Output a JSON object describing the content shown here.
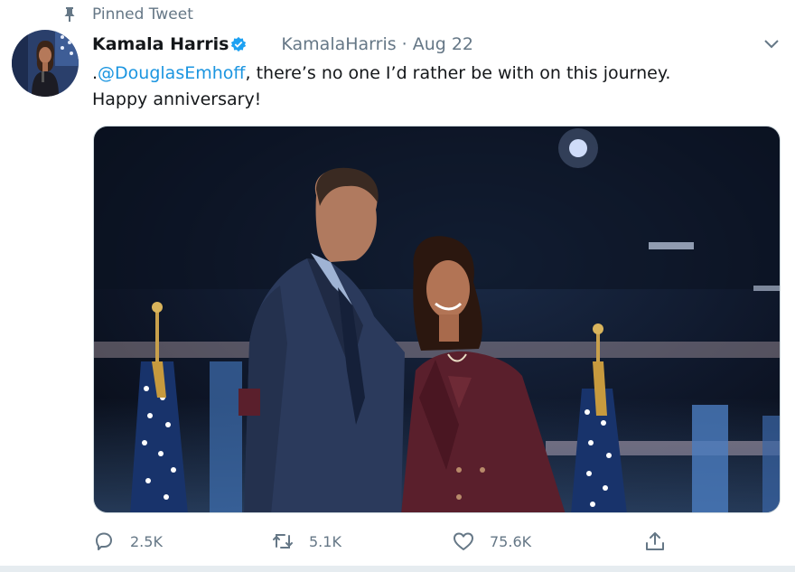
{
  "pinned": {
    "label": "Pinned Tweet",
    "icon": "pin-icon"
  },
  "tweet": {
    "author": {
      "display_name": "Kamala Harris",
      "handle": "KamalaHarris",
      "verified_icon": "verified-badge-icon",
      "avatar": "profile-photo"
    },
    "separator": "·",
    "date": "Aug 22",
    "text_prefix": ".",
    "mention": "@DouglasEmhoff",
    "text_rest": ", there’s no one I’d rather be with on this journey.",
    "text_line2": "Happy anniversary!",
    "media": "photo-couple-on-stage"
  },
  "actions": {
    "reply": {
      "icon": "reply-icon",
      "count": "2.5K"
    },
    "retweet": {
      "icon": "retweet-icon",
      "count": "5.1K"
    },
    "like": {
      "icon": "heart-icon",
      "count": "75.6K"
    },
    "share": {
      "icon": "share-icon"
    }
  },
  "colors": {
    "link": "#1b95e0",
    "muted": "#657786",
    "verified": "#1da1f2"
  }
}
